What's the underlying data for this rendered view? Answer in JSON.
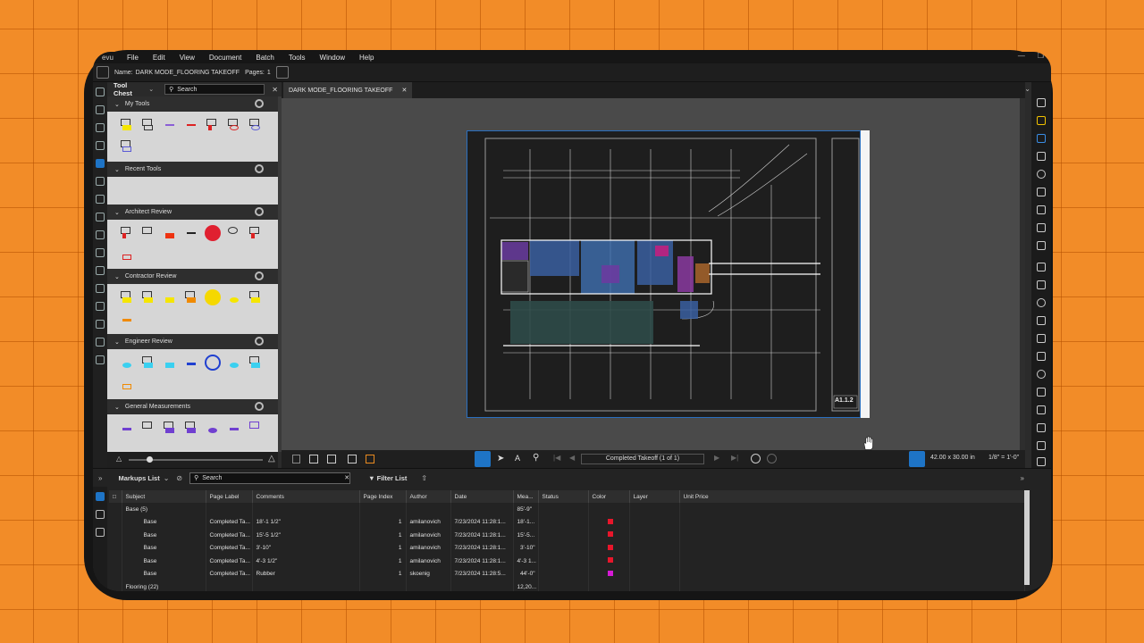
{
  "menubar": {
    "app_fragment": "evu",
    "items": [
      "File",
      "Edit",
      "View",
      "Document",
      "Batch",
      "Tools",
      "Window",
      "Help"
    ]
  },
  "namebar": {
    "name_label": "Name:",
    "name_value": "DARK MODE_FLOORING TAKEOFF",
    "pages_label": "Pages:",
    "pages_value": "1"
  },
  "toolchest": {
    "title": "Tool Chest",
    "search_placeholder": "Search",
    "sections": [
      {
        "name": "My Tools"
      },
      {
        "name": "Recent Tools"
      },
      {
        "name": "Architect Review"
      },
      {
        "name": "Contractor Review"
      },
      {
        "name": "Engineer Review"
      },
      {
        "name": "General Measurements"
      }
    ]
  },
  "document": {
    "tab_label": "DARK MODE_FLOORING TAKEOFF",
    "page_info": "Completed Takeoff (1 of 1)",
    "sheet_number": "A1.1.2",
    "page_size": "42.00 x 30.00 in",
    "scale": "1/8\" = 1'-0\""
  },
  "markups": {
    "title": "Markups List",
    "search_placeholder": "Search",
    "filter_label": "Filter List",
    "columns": [
      "Subject",
      "Page Label",
      "Comments",
      "Page Index",
      "Author",
      "Date",
      "Mea...",
      "Status",
      "Color",
      "Layer",
      "Unit Price"
    ],
    "group_base": {
      "label": "Base (5)",
      "measurement": "85'-9\""
    },
    "rows": [
      {
        "subject": "Base",
        "page_label": "Completed Ta...",
        "comments": "18'-1 1/2\"",
        "page_index": "1",
        "author": "amilanovich",
        "date": "7/23/2024 11:28:1...",
        "measurement": "18'-1...",
        "color": "#e8162b"
      },
      {
        "subject": "Base",
        "page_label": "Completed Ta...",
        "comments": "15'-5 1/2\"",
        "page_index": "1",
        "author": "amilanovich",
        "date": "7/23/2024 11:28:1...",
        "measurement": "15'-5...",
        "color": "#e8162b"
      },
      {
        "subject": "Base",
        "page_label": "Completed Ta...",
        "comments": "3'-10\"",
        "page_index": "1",
        "author": "amilanovich",
        "date": "7/23/2024 11:28:1...",
        "measurement": "3'-10\"",
        "color": "#e8162b"
      },
      {
        "subject": "Base",
        "page_label": "Completed Ta...",
        "comments": "4'-3 1/2\"",
        "page_index": "1",
        "author": "amilanovich",
        "date": "7/23/2024 11:28:1...",
        "measurement": "4'-3 1...",
        "color": "#e8162b"
      },
      {
        "subject": "Base",
        "page_label": "Completed Ta...",
        "comments": "Rubber",
        "page_index": "1",
        "author": "skoenig",
        "date": "7/23/2024 11:28:5...",
        "measurement": "44'-0\"",
        "color": "#d61ad6"
      }
    ],
    "group_flooring": {
      "label": "Flooring (22)",
      "measurement": "12,20..."
    }
  }
}
